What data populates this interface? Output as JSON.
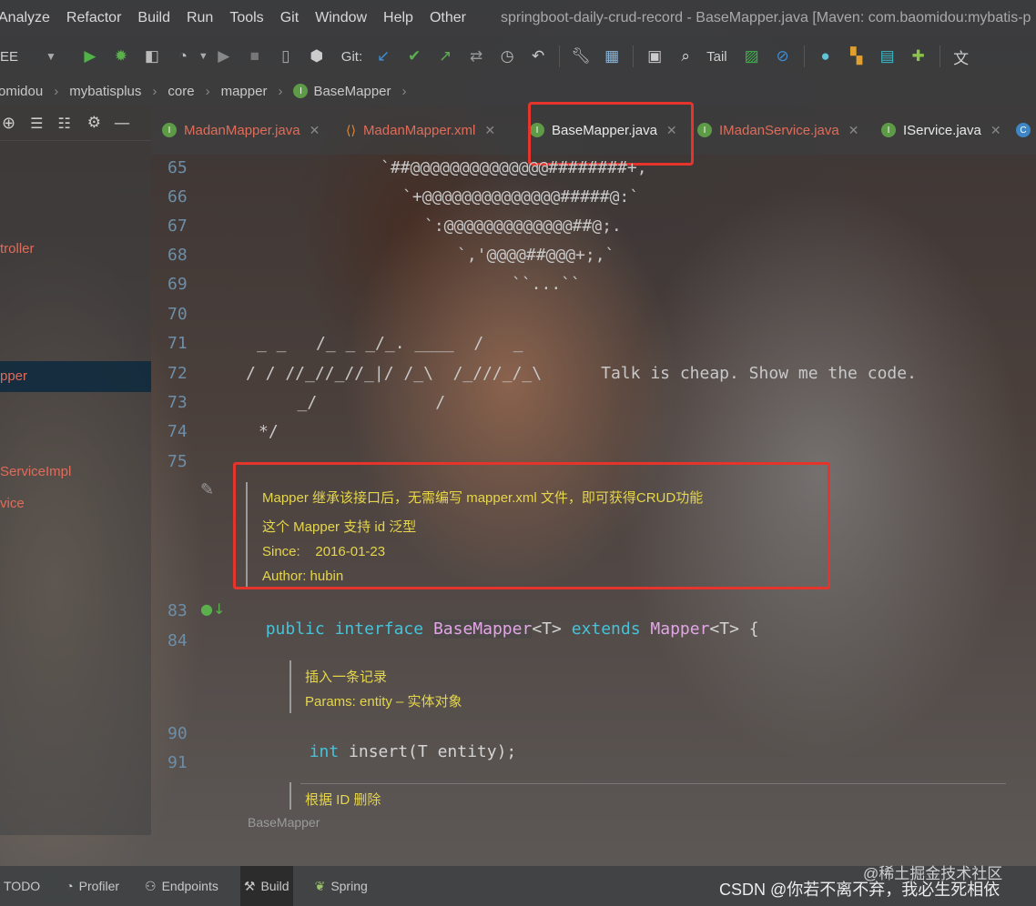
{
  "menu": {
    "items": [
      "Analyze",
      "Refactor",
      "Build",
      "Run",
      "Tools",
      "Git",
      "Window",
      "Help",
      "Other"
    ],
    "title": "springboot-daily-crud-record - BaseMapper.java [Maven: com.baomidou:mybatis-p"
  },
  "toolbar": {
    "config": "EE",
    "git_label": "Git:",
    "tail_label": "Tail"
  },
  "breadcrumb": [
    "omidou",
    "mybatisplus",
    "core",
    "mapper",
    "BaseMapper"
  ],
  "sidebar": {
    "items": [
      "troller",
      "pper",
      "ServiceImpl",
      "vice"
    ]
  },
  "tabs": [
    {
      "label": "MadanMapper.java",
      "icon": "interface-icon",
      "color": "#e06c5a"
    },
    {
      "label": "MadanMapper.xml",
      "icon": "xml-icon",
      "color": "#e06c5a"
    },
    {
      "label": "BaseMapper.java",
      "icon": "interface-icon",
      "color": "#e0e0e0",
      "active": true
    },
    {
      "label": "IMadanService.java",
      "icon": "interface-icon",
      "color": "#e06c5a"
    },
    {
      "label": "IService.java",
      "icon": "interface-icon",
      "color": "#e0e0e0"
    }
  ],
  "editor": {
    "ascii": [
      {
        "n": "65",
        "text": "`##@@@@@@@@@@@@@@########+,"
      },
      {
        "n": "66",
        "text": "`+@@@@@@@@@@@@@@#####@:`"
      },
      {
        "n": "67",
        "text": "`:@@@@@@@@@@@@@##@;."
      },
      {
        "n": "68",
        "text": "`,'@@@@##@@@+;,`"
      },
      {
        "n": "69",
        "text": "``...``"
      },
      {
        "n": "70",
        "text": ""
      },
      {
        "n": "71",
        "text": "_ _   /_ _ _/_. ____  /   _"
      },
      {
        "n": "72",
        "text": "/ / //_//_//_|/ /_\\  /_///_/_\\      Talk is cheap. Show me the code."
      },
      {
        "n": "73",
        "text": "   _/            /"
      },
      {
        "n": "74",
        "text": "*/"
      },
      {
        "n": "75",
        "text": ""
      }
    ],
    "doc1": [
      "Mapper 继承该接口后，无需编写 mapper.xml 文件，即可获得CRUD功能",
      "这个 Mapper 支持 id 泛型",
      "Since:    2016-01-23",
      "Author: hubin"
    ],
    "line83_num": "83",
    "line83": {
      "public": "public",
      "interface": "interface",
      "name": "BaseMapper",
      "generic": "<T>",
      "extends": "extends",
      "parent": "Mapper",
      "tail": "<T> {"
    },
    "line84_num": "84",
    "doc2": [
      "插入一条记录",
      "Params: entity – 实体对象"
    ],
    "line90_num": "90",
    "line90": {
      "type": "int",
      "rest": " insert(T entity);"
    },
    "line91_num": "91",
    "doc3": [
      "根据 ID 删除"
    ],
    "footer_label": "BaseMapper"
  },
  "bottom": {
    "items": [
      "TODO",
      "Profiler",
      "Endpoints",
      "Build",
      "Spring"
    ]
  },
  "watermarks": {
    "juejin": "@稀土掘金技术社区",
    "csdn": "CSDN @你若不离不弃，我必生死相依"
  }
}
